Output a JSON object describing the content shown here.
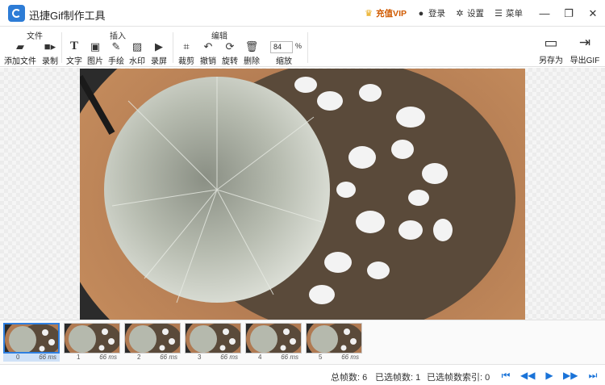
{
  "window": {
    "title": "迅捷Gif制作工具",
    "vip_label": "充值VIP",
    "login_label": "登录",
    "settings_label": "设置",
    "menu_label": "菜单",
    "accent_color": "#2d7cd6",
    "vip_color": "#d05a00"
  },
  "toolbar": {
    "groups": {
      "file": "文件",
      "insert": "插入",
      "edit": "编辑"
    },
    "add_file": "添加文件",
    "record": "录制",
    "text": "文字",
    "image": "图片",
    "handdraw": "手绘",
    "watermark": "水印",
    "screen_record": "录屏",
    "crop": "裁剪",
    "undo": "撤销",
    "rotate": "旋转",
    "delete": "删除",
    "zoom_value": "84",
    "zoom_unit": "%",
    "zoom_label": "缩放",
    "save_as": "另存为",
    "export_gif": "导出GIF"
  },
  "frames": [
    {
      "index": "0",
      "duration": "66 ms"
    },
    {
      "index": "1",
      "duration": "66 ms"
    },
    {
      "index": "2",
      "duration": "66 ms"
    },
    {
      "index": "3",
      "duration": "66 ms"
    },
    {
      "index": "4",
      "duration": "66 ms"
    },
    {
      "index": "5",
      "duration": "66 ms"
    }
  ],
  "status": {
    "total_frames": "总帧数: 6",
    "selected_frames": "已选帧数: 1",
    "selected_index": "已选帧数索引: 0"
  }
}
